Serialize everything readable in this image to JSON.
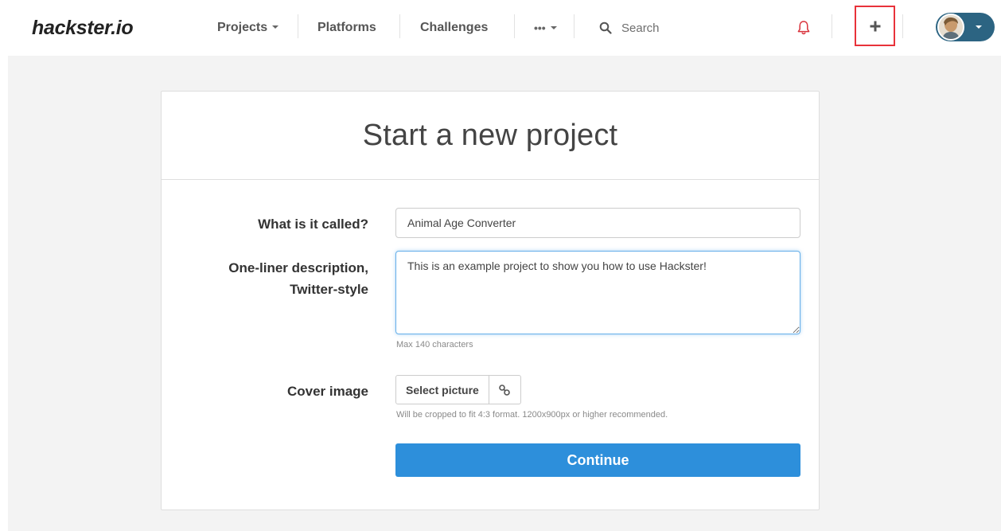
{
  "header": {
    "logo": "hackster.io",
    "nav": {
      "projects": "Projects",
      "platforms": "Platforms",
      "challenges": "Challenges",
      "more": "•••"
    },
    "search": {
      "placeholder": "Search"
    },
    "icons": {
      "notifications": "bell-icon",
      "new_project": "plus-icon",
      "user": "avatar"
    }
  },
  "form": {
    "title": "Start a new project",
    "name_field": {
      "label": "What is it called?",
      "value": "Animal Age Converter"
    },
    "description_field": {
      "label_line1": "One-liner description,",
      "label_line2": "Twitter-style",
      "value": "This is an example project to show you how to use Hackster!",
      "help": "Max 140 characters"
    },
    "cover_image": {
      "label": "Cover image",
      "select_label": "Select picture",
      "help": "Will be cropped to fit 4:3 format. 1200x900px or higher recommended."
    },
    "continue_label": "Continue"
  },
  "colors": {
    "accent": "#2d8fdb",
    "highlight": "#e8323a",
    "bell": "#d9323b",
    "user_menu": "#2c6482"
  }
}
